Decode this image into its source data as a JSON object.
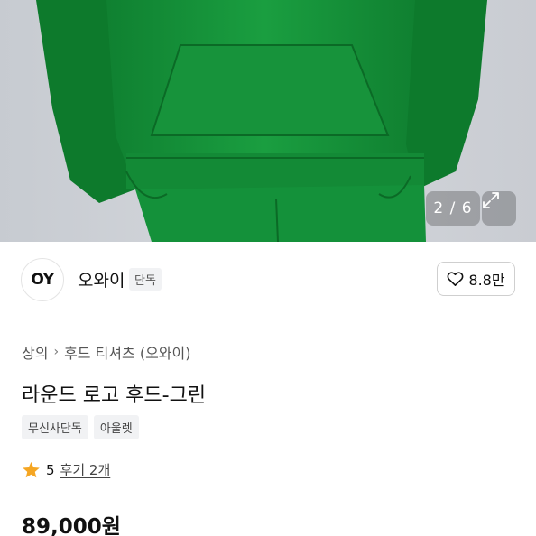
{
  "gallery": {
    "counter": "2 / 6",
    "expand_icon": "expand-arrows-icon",
    "garment_color": "#169a3c"
  },
  "brand": {
    "logo_text": "OY",
    "name": "오와이",
    "badge": "단독",
    "like_icon": "heart-outline-icon",
    "like_count": "8.8만"
  },
  "breadcrumb": {
    "items": [
      "상의",
      "후드 티셔츠 (오와이)"
    ],
    "separator_icon": "chevron-right-icon"
  },
  "product": {
    "title": "라운드 로고 후드-그린",
    "tags": [
      "무신사단독",
      "아울렛"
    ],
    "rating": {
      "star_icon": "star-icon",
      "star_color": "#f5a623",
      "score": "5",
      "reviews": "후기 2개"
    },
    "price": "89,000원"
  }
}
